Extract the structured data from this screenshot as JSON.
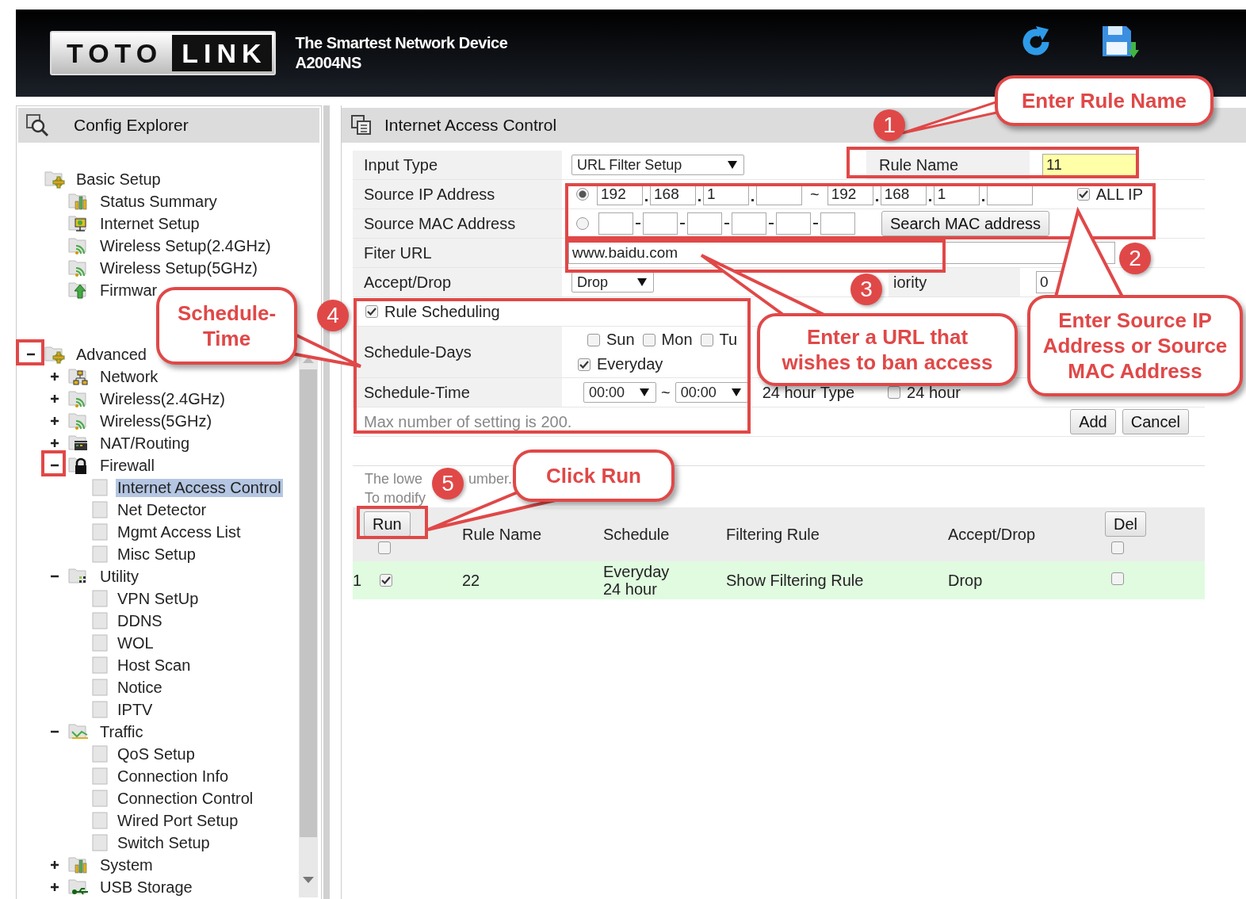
{
  "header": {
    "logo": [
      "TOTO",
      "LINK"
    ],
    "tagline": "The Smartest Network Device",
    "model": "A2004NS"
  },
  "sidebar": {
    "title": "Config Explorer",
    "tree": [
      {
        "label": "Basic Setup",
        "kind": "setup",
        "selected": false,
        "children": [
          {
            "label": "Status Summary",
            "kind": "chart",
            "selected": false
          },
          {
            "label": "Internet Setup",
            "kind": "monitor",
            "selected": false
          },
          {
            "label": "Wireless Setup(2.4GHz)",
            "kind": "wireless",
            "selected": false
          },
          {
            "label": "Wireless Setup(5GHz)",
            "kind": "wireless",
            "selected": false
          },
          {
            "label": "Firmwar",
            "kind": "upgrade",
            "selected": false
          }
        ]
      },
      {
        "label": "Advanced",
        "kind": "setup",
        "expanded": true,
        "selected": false,
        "children": [
          {
            "label": "Network",
            "kind": "network",
            "expanded": false,
            "selected": false
          },
          {
            "label": "Wireless(2.4GHz)",
            "kind": "wireless",
            "expanded": false,
            "selected": false
          },
          {
            "label": "Wireless(5GHz)",
            "kind": "wireless",
            "expanded": false,
            "selected": false
          },
          {
            "label": "NAT/Routing",
            "kind": "router",
            "expanded": false,
            "selected": false
          },
          {
            "label": "Firewall",
            "kind": "lock",
            "expanded": true,
            "selected": false,
            "children": [
              {
                "label": "Internet Access Control",
                "kind": "page",
                "selected": true
              },
              {
                "label": "Net Detector",
                "kind": "page",
                "selected": false
              },
              {
                "label": "Mgmt Access List",
                "kind": "page",
                "selected": false
              },
              {
                "label": "Misc Setup",
                "kind": "page",
                "selected": false
              }
            ]
          },
          {
            "label": "Utility",
            "kind": "utility",
            "expanded": true,
            "selected": false,
            "children": [
              {
                "label": "VPN SetUp",
                "kind": "page",
                "selected": false
              },
              {
                "label": "DDNS",
                "kind": "page",
                "selected": false
              },
              {
                "label": "WOL",
                "kind": "page",
                "selected": false
              },
              {
                "label": "Host Scan",
                "kind": "page",
                "selected": false
              },
              {
                "label": "Notice",
                "kind": "page",
                "selected": false
              },
              {
                "label": "IPTV",
                "kind": "page",
                "selected": false
              }
            ]
          },
          {
            "label": "Traffic",
            "kind": "traffic",
            "expanded": true,
            "selected": false,
            "children": [
              {
                "label": "QoS Setup",
                "kind": "page",
                "selected": false
              },
              {
                "label": "Connection Info",
                "kind": "page",
                "selected": false
              },
              {
                "label": "Connection Control",
                "kind": "page",
                "selected": false
              },
              {
                "label": "Wired Port Setup",
                "kind": "page",
                "selected": false
              },
              {
                "label": "Switch Setup",
                "kind": "page",
                "selected": false
              }
            ]
          },
          {
            "label": "System",
            "kind": "chart",
            "expanded": false,
            "selected": false
          },
          {
            "label": "USB Storage",
            "kind": "usb",
            "expanded": false,
            "selected": false
          }
        ]
      }
    ]
  },
  "panel": {
    "title": "Internet Access Control"
  },
  "form": {
    "input_type": {
      "label": "Input Type",
      "value": "URL Filter Setup"
    },
    "rule_name": {
      "label": "Rule Name",
      "value": "11"
    },
    "source_ip": {
      "label": "Source IP Address",
      "selected": true,
      "from": [
        "192",
        "168",
        "1"
      ],
      "range_sign": "~",
      "to": [
        "192",
        "168",
        "1"
      ],
      "all_ip": {
        "label": "ALL IP",
        "checked": true
      }
    },
    "source_mac": {
      "label": "Source MAC Address",
      "selected": false,
      "button": "Search MAC address"
    },
    "filter_url": {
      "label": "Fiter URL",
      "value": "www.baidu.com"
    },
    "accept_drop": {
      "label": "Accept/Drop",
      "value": "Drop"
    },
    "priority": {
      "label": "iority",
      "value": "0"
    },
    "rule_scheduling": {
      "label": "Rule Scheduling",
      "checked": true
    },
    "schedule_days": {
      "label": "Schedule-Days",
      "days": [
        {
          "label": "Sun",
          "checked": false
        },
        {
          "label": "Mon",
          "checked": false
        },
        {
          "label": "Tu",
          "checked": false
        }
      ],
      "everyday": {
        "label": "Everyday",
        "checked": true
      }
    },
    "schedule_time": {
      "label": "Schedule-Time",
      "start": "00:00",
      "range_sign": "~",
      "end": "00:00",
      "type_label": "24 hour Type",
      "hour24": {
        "label": "24 hour",
        "checked": false
      }
    },
    "max_note": "Max number of setting is 200.",
    "buttons": [
      "Add",
      "Cancel"
    ]
  },
  "rule_list": {
    "note": [
      "The lowe",
      "umber."
    ],
    "note_2": "To modify",
    "run_button": "Run",
    "select_all_checked": false,
    "columns": [
      "Rule Name",
      "Schedule",
      "Filtering Rule",
      "Accept/Drop"
    ],
    "del_button": "Del",
    "delete_all_checked": false,
    "rows": [
      {
        "index": "1",
        "enabled": true,
        "rule_name": "22",
        "schedule": [
          "Everyday",
          "24 hour"
        ],
        "filtering_rule": "Show Filtering Rule",
        "action": "Drop",
        "delete": false
      }
    ]
  },
  "annotations": [
    {
      "number": "1",
      "text": "Enter Rule Name"
    },
    {
      "number": "4",
      "text": "Schedule-Time"
    },
    {
      "number": "3",
      "text": "Enter a URL that wishes to ban access"
    },
    {
      "number": "2",
      "text": "Enter Source IP Address or Source MAC Address"
    },
    {
      "number": "5",
      "text": "Click Run"
    }
  ]
}
